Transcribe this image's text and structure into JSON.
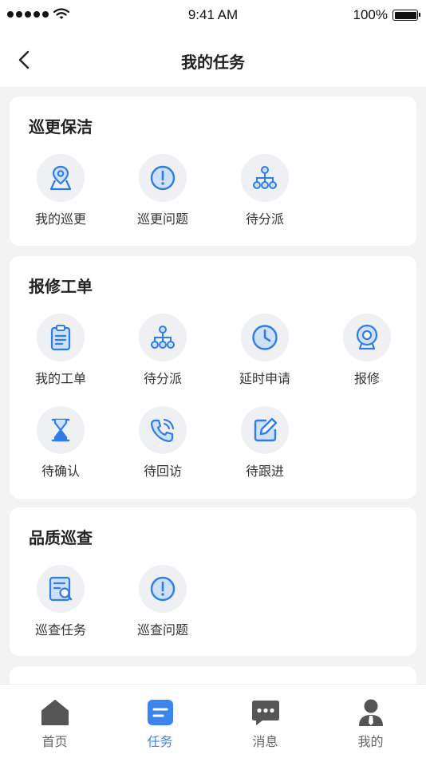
{
  "status_bar": {
    "time": "9:41 AM",
    "battery": "100%"
  },
  "header": {
    "title": "我的任务"
  },
  "sections": [
    {
      "title": "巡更保洁",
      "items": [
        {
          "label": "我的巡更",
          "icon": "location-map-icon"
        },
        {
          "label": "巡更问题",
          "icon": "alert-circle-icon"
        },
        {
          "label": "待分派",
          "icon": "org-tree-icon"
        }
      ]
    },
    {
      "title": "报修工单",
      "items": [
        {
          "label": "我的工单",
          "icon": "clipboard-icon"
        },
        {
          "label": "待分派",
          "icon": "org-tree-icon"
        },
        {
          "label": "延时申请",
          "icon": "clock-icon"
        },
        {
          "label": "报修",
          "icon": "camera-icon"
        },
        {
          "label": "待确认",
          "icon": "hourglass-icon"
        },
        {
          "label": "待回访",
          "icon": "phone-call-icon"
        },
        {
          "label": "待跟进",
          "icon": "edit-icon"
        }
      ]
    },
    {
      "title": "品质巡查",
      "items": [
        {
          "label": "巡查任务",
          "icon": "document-search-icon"
        },
        {
          "label": "巡查问题",
          "icon": "alert-circle-icon"
        }
      ]
    }
  ],
  "tabbar": {
    "items": [
      {
        "label": "首页",
        "icon": "home-icon",
        "active": false
      },
      {
        "label": "任务",
        "icon": "task-icon",
        "active": true
      },
      {
        "label": "消息",
        "icon": "chat-icon",
        "active": false
      },
      {
        "label": "我的",
        "icon": "profile-icon",
        "active": false
      }
    ]
  },
  "colors": {
    "accent": "#3b86ee",
    "icon_bg": "#eef0f4",
    "page_bg": "#f3f3f3"
  }
}
